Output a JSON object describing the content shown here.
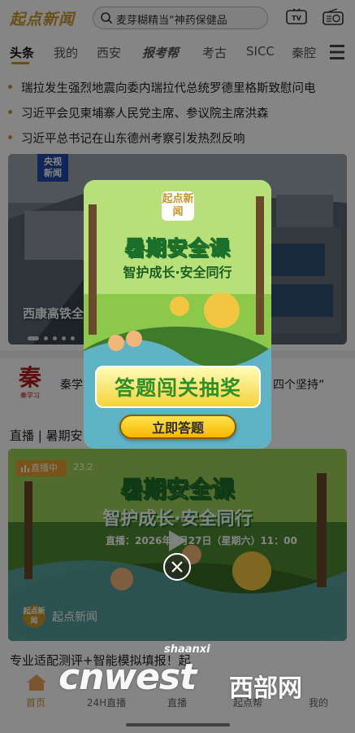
{
  "header": {
    "logo_text": "起点新闻",
    "search_text": "麦芽糊精当“神药保健品",
    "icons": [
      "search-icon",
      "tv-icon",
      "radio-icon"
    ],
    "tv_label": "TV"
  },
  "tabs": [
    "头条",
    "我的",
    "西安",
    "报考帮",
    "考古",
    "SICC",
    "秦腔"
  ],
  "headlines": [
    "瑞拉发生强烈地震向委内瑞拉代总统罗德里格斯致慰问电",
    "习近平会见柬埔寨人民党主席、参议院主席洪森",
    "习近平总书记在山东德州考察引发热烈反响"
  ],
  "hero": {
    "badge_line1": "央视",
    "badge_line2": "新闻",
    "caption": "西康高铁全"
  },
  "qin": {
    "logo_char": "秦",
    "logo_sub": "秦学习",
    "text_left": "秦学",
    "text_right": "四个坚持”"
  },
  "live": {
    "section_title": "直播 | 暑期安",
    "badge": "直播中",
    "time": "23.2",
    "card_title": "暑期安全课",
    "card_subtitle": "智护成长·安全同行",
    "broadcast_text": "直播：2026年6月27日（星期六）11：00",
    "source_logo": "起点新闻",
    "source": "起点新闻"
  },
  "bottom_headline": "专业适配测评+智能模拟填报！起",
  "popup": {
    "logo": "起点新闻",
    "title": "暑期安全课",
    "subtitle": "智护成长·安全同行",
    "quiz": "答题闯关抽奖",
    "button": "立即答题"
  },
  "nav": [
    "首页",
    "24H直播",
    "直播",
    "起点帮",
    "我的"
  ],
  "watermark": {
    "shaanxi": "shaanxi",
    "cnwest": "cnwest",
    "cn_name": "西部网"
  },
  "colors": {
    "brand": "#c8962c",
    "overlay": "rgba(0,0,0,0.48)"
  }
}
